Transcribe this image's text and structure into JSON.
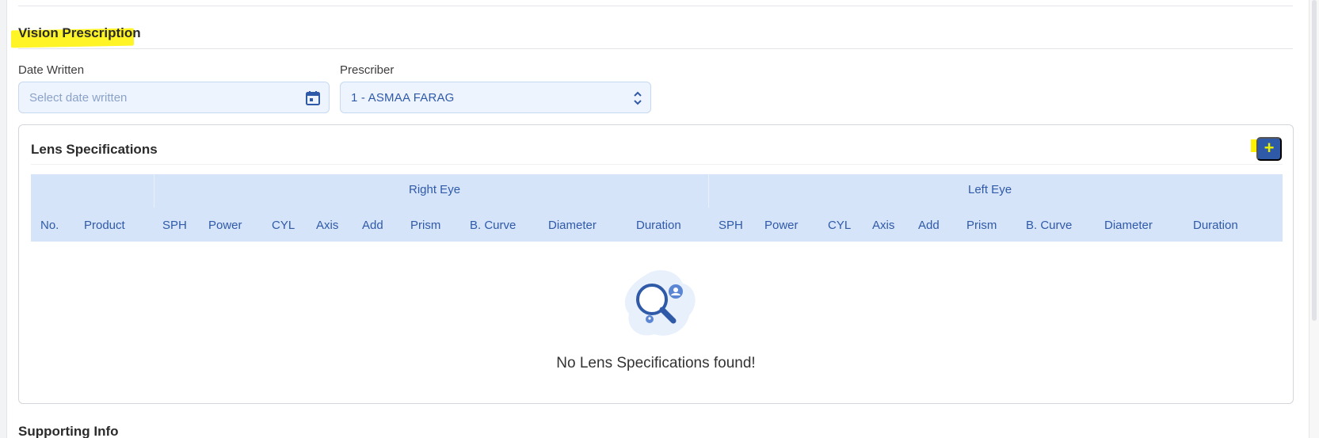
{
  "section": {
    "title": "Vision Prescription"
  },
  "form": {
    "date_label": "Date Written",
    "date_placeholder": "Select date written",
    "date_icon": "calendar-icon",
    "prescriber_label": "Prescriber",
    "prescriber_value": "1 - ASMAA FARAG",
    "prescriber_icon": "sort-chevrons-icon"
  },
  "lens_card": {
    "title": "Lens Specifications",
    "add_label": "+",
    "add_icon": "plus-icon",
    "groups": {
      "right": "Right Eye",
      "left": "Left Eye"
    },
    "columns": {
      "no": "No.",
      "product": "Product",
      "right": [
        "SPH",
        "Power",
        "CYL",
        "Axis",
        "Add",
        "Prism",
        "B. Curve",
        "Diameter",
        "Duration"
      ],
      "left": [
        "SPH",
        "Power",
        "CYL",
        "Axis",
        "Add",
        "Prism",
        "B. Curve",
        "Diameter",
        "Duration"
      ]
    },
    "empty_icon": "search-empty-icon",
    "empty_message": "No Lens Specifications found!"
  },
  "next_section": {
    "title": "Supporting Info"
  },
  "colors": {
    "accent": "#2f5aa8",
    "table_header_bg": "#d6e4fa",
    "input_bg": "#eef4fd",
    "highlight": "#fff200"
  }
}
